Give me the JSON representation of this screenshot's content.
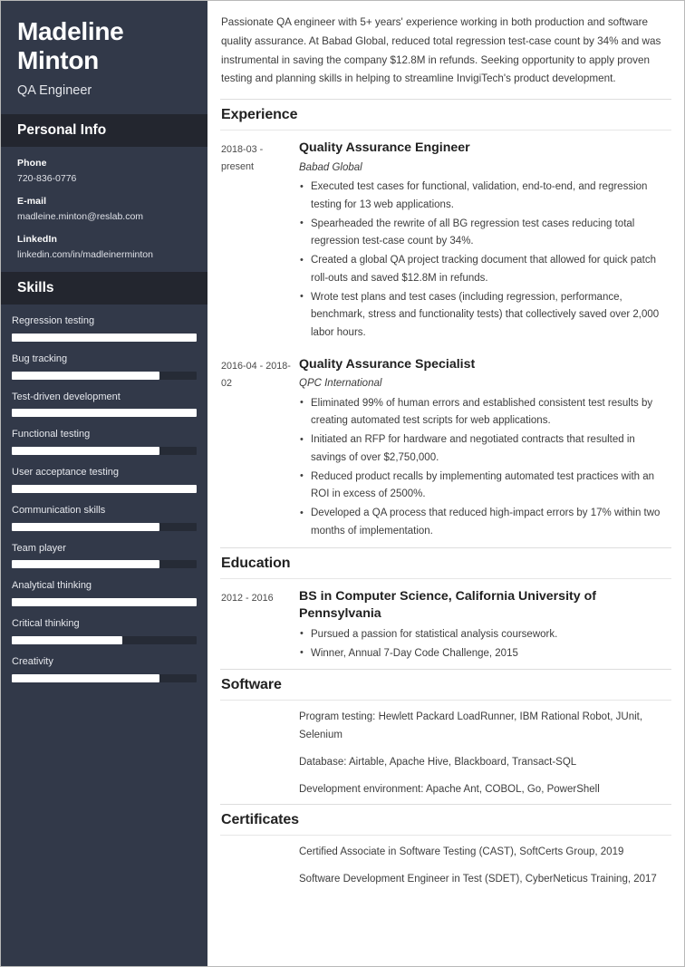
{
  "theme": {
    "sidebar_bg": "#323949",
    "sidebar_band_bg": "#23262f",
    "skill_fill": "#ffffff",
    "skill_track": "#262b36",
    "text_dark": "#3d3d3d",
    "rule": "#dddddd"
  },
  "sidebar": {
    "name": "Madeline Minton",
    "job_title": "QA Engineer",
    "personal_info_heading": "Personal Info",
    "contacts": [
      {
        "label": "Phone",
        "value": "720-836-0776"
      },
      {
        "label": "E-mail",
        "value": "madleine.minton@reslab.com"
      },
      {
        "label": "LinkedIn",
        "value": "linkedin.com/in/madleinerminton"
      }
    ],
    "skills_heading": "Skills",
    "skills": [
      {
        "name": "Regression testing",
        "level": 100
      },
      {
        "name": "Bug tracking",
        "level": 80
      },
      {
        "name": "Test-driven development",
        "level": 100
      },
      {
        "name": "Functional testing",
        "level": 80
      },
      {
        "name": "User acceptance testing",
        "level": 100
      },
      {
        "name": "Communication skills",
        "level": 80
      },
      {
        "name": "Team player",
        "level": 80
      },
      {
        "name": "Analytical thinking",
        "level": 100
      },
      {
        "name": "Critical thinking",
        "level": 60
      },
      {
        "name": "Creativity",
        "level": 80
      }
    ]
  },
  "main": {
    "summary": "Passionate QA engineer with 5+ years' experience working in both production and software quality assurance. At Babad Global, reduced total regression test-case count by 34% and was instrumental in saving the company $12.8M in refunds. Seeking opportunity to apply proven testing and planning skills in helping to streamline InvigiTech's product development.",
    "sections": {
      "experience": {
        "heading": "Experience",
        "entries": [
          {
            "date": "2018-03 - present",
            "role": "Quality Assurance Engineer",
            "org": "Babad Global",
            "bullets": [
              "Executed test cases for functional, validation, end-to-end, and regression testing for 13 web applications.",
              "Spearheaded the rewrite of all BG regression test cases reducing total regression test-case count by 34%.",
              "Created a global QA project tracking document that allowed for quick patch roll-outs and saved $12.8M in refunds.",
              "Wrote test plans and test cases (including regression, performance, benchmark, stress and functionality tests) that collectively saved over 2,000 labor hours."
            ]
          },
          {
            "date": "2016-04 - 2018-02",
            "role": "Quality Assurance Specialist",
            "org": "QPC International",
            "bullets": [
              "Eliminated 99% of human errors and established consistent test results by creating automated test scripts for web applications.",
              "Initiated an RFP for hardware and negotiated contracts that resulted in savings of over $2,750,000.",
              "Reduced product recalls by implementing automated test practices with an ROI in excess of 2500%.",
              "Developed a QA process that reduced high-impact errors by 17% within two months of implementation."
            ]
          }
        ]
      },
      "education": {
        "heading": "Education",
        "entries": [
          {
            "date": "2012 - 2016",
            "role": "BS in Computer Science, California University of Pennsylvania",
            "org": "",
            "bullets": [
              "Pursued a passion for statistical analysis coursework.",
              "Winner, Annual 7-Day Code Challenge, 2015"
            ]
          }
        ]
      },
      "software": {
        "heading": "Software",
        "lines": [
          "Program testing: Hewlett Packard LoadRunner, IBM Rational Robot, JUnit, Selenium",
          "Database: Airtable, Apache Hive, Blackboard, Transact-SQL",
          "Development environment: Apache Ant, COBOL, Go, PowerShell"
        ]
      },
      "certificates": {
        "heading": "Certificates",
        "lines": [
          "Certified Associate in Software Testing (CAST), SoftCerts Group, 2019",
          "Software Development Engineer in Test (SDET), CyberNeticus Training, 2017"
        ]
      }
    }
  }
}
